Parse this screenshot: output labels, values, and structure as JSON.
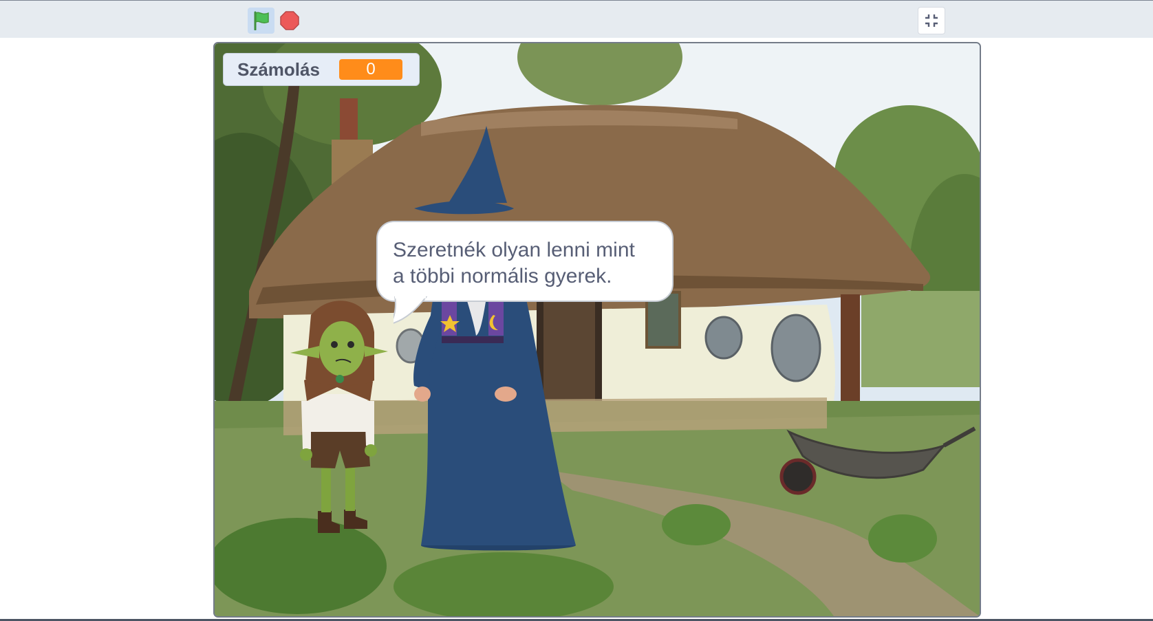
{
  "toolbar": {
    "green_flag_icon": "green-flag-icon",
    "stop_icon": "stop-sign-icon",
    "fullscreen_icon": "exit-fullscreen-icon"
  },
  "stage": {
    "variable_monitor": {
      "label": "Számolás",
      "value": "0"
    },
    "speech_bubble": {
      "line1": "Szeretnék olyan lenni mint",
      "line2": "a többi normális gyerek."
    },
    "sprites": [
      "goblin",
      "wizard"
    ],
    "backdrop": "thatched cottage"
  },
  "colors": {
    "topbar": "#e6ebf0",
    "flag_active_bg": "#c9dcf2",
    "flag_green": "#4cbf56",
    "stop_red": "#ec5959",
    "monitor_value_bg": "#ff8c1a",
    "wizard_robe": "#2a4d7a"
  }
}
